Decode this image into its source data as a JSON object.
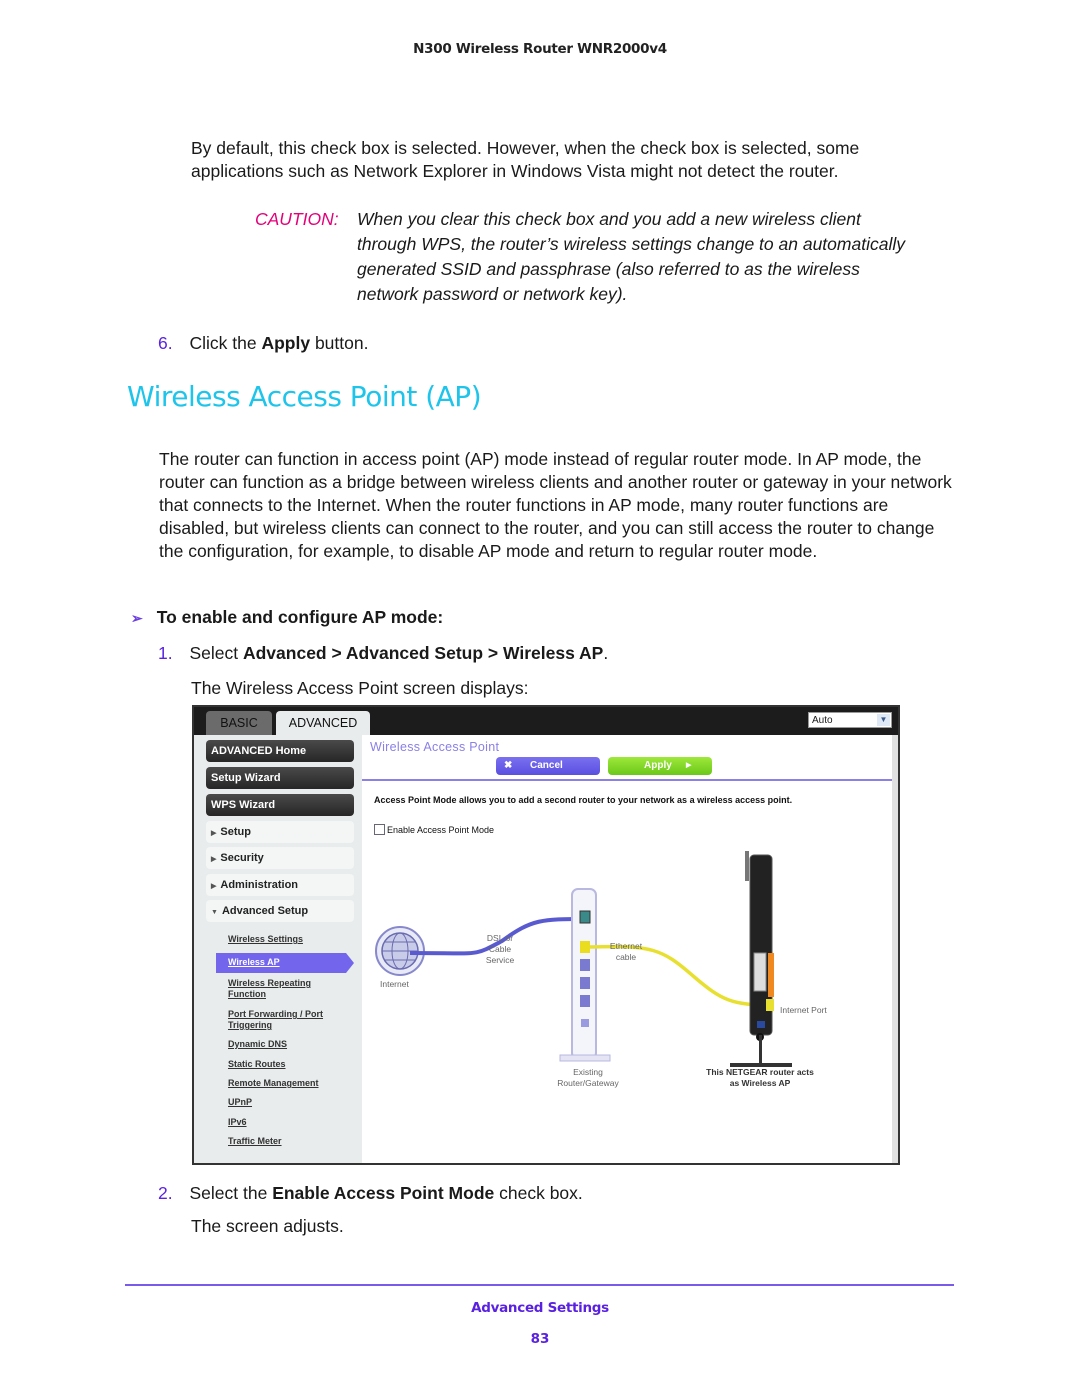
{
  "header": {
    "product": "N300 Wireless Router WNR2000v4"
  },
  "intro": {
    "paragraph": "By default, this check box is selected. However, when the check box is selected, some applications such as Network Explorer in Windows Vista might not detect the router."
  },
  "caution": {
    "label": "CAUTION:",
    "text": "When you clear this check box and you add a new wireless client through WPS, the router’s wireless settings change to an automatically generated SSID and passphrase (also referred to as the wireless network password or network key)."
  },
  "step6": {
    "number": "6.",
    "pre": "Click the ",
    "bold": "Apply",
    "post": " button."
  },
  "section": {
    "title": "Wireless Access Point (AP)",
    "paragraph": "The router can function in access point (AP) mode instead of regular router mode. In AP mode, the router can function as a bridge between wireless clients and another router or gateway in your network that connects to the Internet. When the router functions in AP mode, many router functions are disabled, but wireless clients can connect to the router, and you can still access the router to change the configuration, for example, to disable AP mode and return to regular router mode."
  },
  "procedure": {
    "arrow": "➢",
    "title": "To enable and configure AP mode:",
    "steps": [
      {
        "number": "1.",
        "pre": "Select ",
        "bold": "Advanced > Advanced Setup > Wireless AP",
        "post": ".",
        "note": "The Wireless Access Point screen displays:"
      },
      {
        "number": "2.",
        "pre": "Select the ",
        "bold": "Enable Access Point Mode",
        "post": " check box.",
        "note": "The screen adjusts."
      }
    ]
  },
  "screenshot": {
    "tabs": [
      {
        "label": "BASIC"
      },
      {
        "label": "ADVANCED"
      }
    ],
    "language": "Auto",
    "sidebar": {
      "primary": [
        "ADVANCED Home",
        "Setup Wizard",
        "WPS Wizard"
      ],
      "sections": [
        "Setup",
        "Security",
        "Administration",
        "Advanced Setup"
      ],
      "sublinks": [
        "Wireless Settings",
        "Wireless AP",
        "Wireless Repeating Function",
        "Port Forwarding / Port Triggering",
        "Dynamic DNS",
        "Static Routes",
        "Remote Management",
        "UPnP",
        "IPv6",
        "Traffic Meter"
      ],
      "active": "Wireless AP"
    },
    "page_title": "Wireless Access Point",
    "cancel_label": "Cancel",
    "apply_label": "Apply",
    "description": "Access Point Mode allows you to add a second router to your network as a wireless access point.",
    "checkbox_label": "Enable Access Point Mode",
    "checkbox_checked": false,
    "diagram": {
      "internet": "Internet",
      "dsl": "DSL or Cable Service",
      "ethernet": "Ethernet cable",
      "internet_port": "Internet Port",
      "existing": "Existing Router/Gateway",
      "netgear": "This NETGEAR router acts as Wireless AP"
    }
  },
  "footer": {
    "section": "Advanced Settings",
    "page": "83"
  }
}
